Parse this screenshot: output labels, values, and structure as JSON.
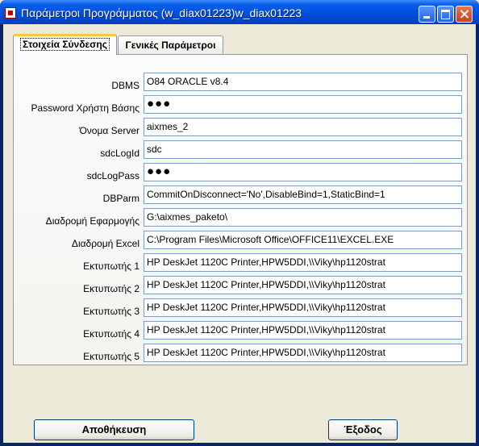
{
  "window": {
    "title": "Παράμετροι Προγράμματος   (w_diax01223)w_diax01223"
  },
  "tabs": [
    {
      "label": "Στοιχεία Σύνδεσης",
      "active": true
    },
    {
      "label": "Γενικές Παράμετροι",
      "active": false
    }
  ],
  "fields": [
    {
      "label": "DBMS",
      "value": "O84 ORACLE v8.4"
    },
    {
      "label": "Password Χρήστη Βάσης",
      "value": "●●●"
    },
    {
      "label": "Όνομα Server",
      "value": "aixmes_2"
    },
    {
      "label": "sdcLogId",
      "value": "sdc"
    },
    {
      "label": "sdcLogPass",
      "value": "●●●"
    },
    {
      "label": "DBParm",
      "value": "CommitOnDisconnect='No',DisableBind=1,StaticBind=1"
    },
    {
      "label": "Διαδρομή Εφαρμογής",
      "value": "G:\\aixmes_paketo\\"
    },
    {
      "label": "Διαδρομή Excel",
      "value": "C:\\Program Files\\Microsoft Office\\OFFICE11\\EXCEL.EXE"
    },
    {
      "label": "Εκτυπωτής 1",
      "value": "HP DeskJet 1120C Printer,HPW5DDI,\\\\Viky\\hp1120strat"
    },
    {
      "label": "Εκτυπωτής 2",
      "value": "HP DeskJet 1120C Printer,HPW5DDI,\\\\Viky\\hp1120strat"
    },
    {
      "label": "Εκτυπωτής 3",
      "value": "HP DeskJet 1120C Printer,HPW5DDI,\\\\Viky\\hp1120strat"
    },
    {
      "label": "Εκτυπωτής 4",
      "value": "HP DeskJet 1120C Printer,HPW5DDI,\\\\Viky\\hp1120strat"
    },
    {
      "label": "Εκτυπωτής 5",
      "value": "HP DeskJet 1120C Printer,HPW5DDI,\\\\Viky\\hp1120strat"
    }
  ],
  "buttons": {
    "save_label": "Αποθήκευση",
    "exit_label": "Έξοδος"
  },
  "colors": {
    "titlebar": "#0054e3",
    "face": "#ece9d8",
    "active_tab_accent": "#ffc83c"
  }
}
